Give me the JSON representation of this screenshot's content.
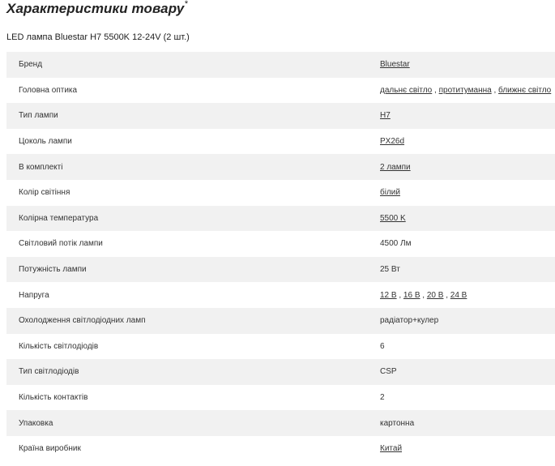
{
  "header": {
    "title": "Характеристики товару",
    "title_mark": "*",
    "product_name": "LED лампа Bluestar H7 5500K 12-24V (2 шт.)"
  },
  "specs": [
    {
      "name": "Бренд",
      "values": [
        {
          "text": "Bluestar",
          "link": true
        }
      ]
    },
    {
      "name": "Головна оптика",
      "values": [
        {
          "text": "дальнє світло",
          "link": true
        },
        {
          "text": "протитуманна",
          "link": true
        },
        {
          "text": "ближнє світло",
          "link": true
        }
      ]
    },
    {
      "name": "Тип лампи",
      "values": [
        {
          "text": "H7",
          "link": true
        }
      ]
    },
    {
      "name": "Цоколь лампи",
      "values": [
        {
          "text": "PX26d",
          "link": true
        }
      ]
    },
    {
      "name": "В комплекті",
      "values": [
        {
          "text": "2 лампи",
          "link": true
        }
      ]
    },
    {
      "name": "Колір світіння",
      "values": [
        {
          "text": "білий",
          "link": true
        }
      ]
    },
    {
      "name": "Колірна температура",
      "values": [
        {
          "text": "5500 K",
          "link": true
        }
      ]
    },
    {
      "name": "Світловий потік лампи",
      "values": [
        {
          "text": "4500 Лм",
          "link": false
        }
      ]
    },
    {
      "name": "Потужність лампи",
      "values": [
        {
          "text": "25 Вт",
          "link": false
        }
      ]
    },
    {
      "name": "Напруга",
      "values": [
        {
          "text": "12 В",
          "link": true
        },
        {
          "text": "16 В",
          "link": true
        },
        {
          "text": "20 В",
          "link": true
        },
        {
          "text": "24 В",
          "link": true
        }
      ]
    },
    {
      "name": "Охолодження світлодіодних ламп",
      "values": [
        {
          "text": "радіатор+кулер",
          "link": false
        }
      ]
    },
    {
      "name": "Кількість світлодіодів",
      "values": [
        {
          "text": "6",
          "link": false
        }
      ]
    },
    {
      "name": "Тип світлодіодів",
      "values": [
        {
          "text": "CSP",
          "link": false
        }
      ]
    },
    {
      "name": "Кількість контактів",
      "values": [
        {
          "text": "2",
          "link": false
        }
      ]
    },
    {
      "name": "Упаковка",
      "values": [
        {
          "text": "картонна",
          "link": false
        }
      ]
    },
    {
      "name": "Країна виробник",
      "values": [
        {
          "text": "Китай",
          "link": true
        }
      ]
    }
  ],
  "value_separator": ","
}
